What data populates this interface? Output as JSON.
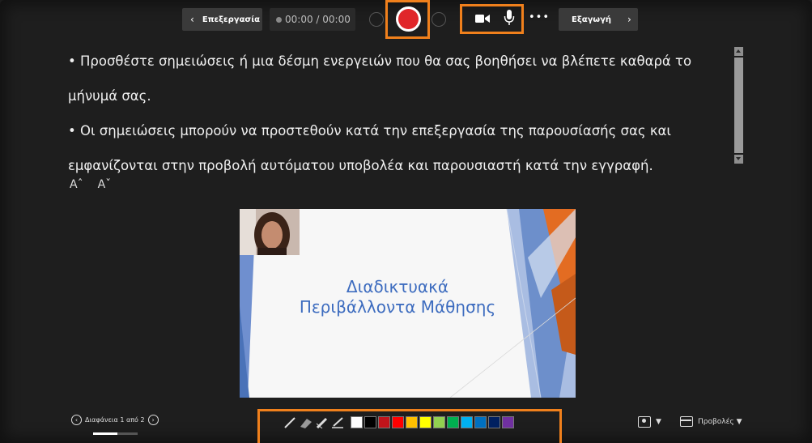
{
  "toolbar": {
    "edit_label": "Επεξεργασία",
    "edit_chevron": "‹",
    "timer": "00:00 / 00:00",
    "export_label": "Εξαγωγή",
    "export_chevron": "›",
    "more": "•••"
  },
  "notes": {
    "lines": [
      "• Προσθέστε σημειώσεις ή μια δέσμη ενεργειών που θα σας βοηθήσει να βλέπετε καθαρά το",
      "μήνυμά σας.",
      "• Οι σημειώσεις μπορούν να προστεθούν κατά την επεξεργασία της παρουσίασής σας και",
      "εμφανίζονται στην προβολή αυτόματου υποβολέα και παρουσιαστή κατά την εγγραφή."
    ],
    "font_increase": "Aˆ",
    "font_decrease": "Aˇ"
  },
  "slide": {
    "title_line1": "Διαδικτυακά",
    "title_line2": "Περιβάλλοντα Μάθησης"
  },
  "slide_nav": {
    "label": "Διαφάνεια 1 από 2",
    "prev": "‹",
    "next": "›",
    "progress": 0.55
  },
  "pen_tools": [
    "pen-tool",
    "eraser-tool",
    "highlighter-tool",
    "laser-pen-tool"
  ],
  "colors": [
    "#ffffff",
    "#000000",
    "#c0141b",
    "#ff0000",
    "#ffc000",
    "#ffff00",
    "#92d050",
    "#00b050",
    "#00b0f0",
    "#0070c0",
    "#002060",
    "#7030a0",
    "#ff00ff"
  ],
  "bottom_right": {
    "presenter_arrow": "▼",
    "views_label": "Προβολές ▼"
  },
  "accent": "#f0801c"
}
